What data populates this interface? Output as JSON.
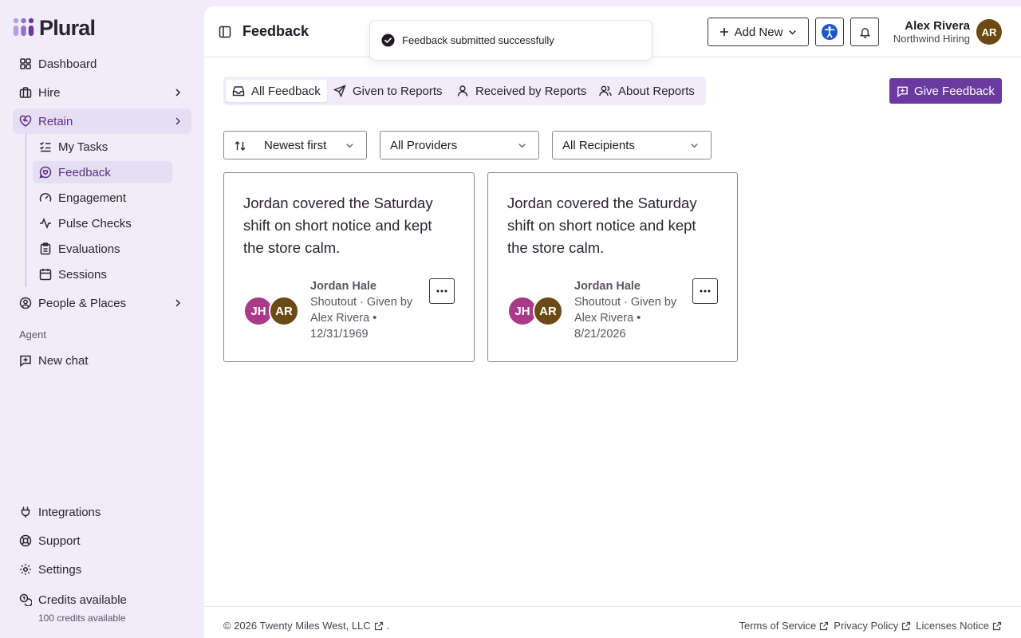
{
  "app": {
    "name": "Plural"
  },
  "sidebar": {
    "dashboard": "Dashboard",
    "hire": "Hire",
    "retain": "Retain",
    "sub": {
      "my_tasks": "My Tasks",
      "feedback": "Feedback",
      "engagement": "Engagement",
      "pulse_checks": "Pulse Checks",
      "evaluations": "Evaluations",
      "sessions": "Sessions"
    },
    "people_places": "People & Places",
    "agent_label": "Agent",
    "new_chat": "New chat",
    "integrations": "Integrations",
    "support": "Support",
    "settings": "Settings",
    "credits_title": "Credits available",
    "credits_sub": "100 credits available"
  },
  "header": {
    "title": "Feedback",
    "add_new": "Add New",
    "user_name": "Alex Rivera",
    "user_org": "Northwind Hiring",
    "user_initials": "AR"
  },
  "toast": {
    "message": "Feedback submitted successfully"
  },
  "tabs": {
    "all": "All Feedback",
    "given": "Given to Reports",
    "received": "Received by Reports",
    "about": "About Reports"
  },
  "give_feedback": "Give Feedback",
  "filters": {
    "sort": "Newest first",
    "providers": "All Providers",
    "recipients": "All Recipients"
  },
  "cards": [
    {
      "text": "Jordan covered the Saturday shift on short notice and kept the store calm.",
      "author": "Jordan Hale",
      "meta": "Shoutout · Given by Alex Rivera •",
      "date": "12/31/1969",
      "initials1": "JH",
      "initials2": "AR"
    },
    {
      "text": "Jordan covered the Saturday shift on short notice and kept the store calm.",
      "author": "Jordan Hale",
      "meta": "Shoutout · Given by Alex Rivera •",
      "date": "8/21/2026",
      "initials1": "JH",
      "initials2": "AR"
    }
  ],
  "footer": {
    "copyright": "© 2026 Twenty Miles West, LLC",
    "dot": ".",
    "terms": "Terms of Service",
    "privacy": "Privacy Policy",
    "licenses": "Licenses Notice"
  },
  "colors": {
    "accent": "#6a3aa0",
    "sidebar_bg": "#f1ecfa",
    "avatar_brown": "#6b4a13",
    "avatar_magenta": "#a83a8a"
  }
}
